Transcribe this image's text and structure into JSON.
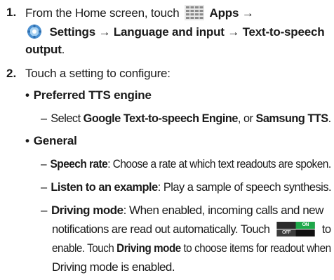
{
  "step1": {
    "number": "1.",
    "intro": "From the Home screen, touch",
    "apps_label": "Apps →",
    "path": "Settings → Language and input → Text-to-speech",
    "path_end": "output",
    "period": "."
  },
  "step2": {
    "number": "2.",
    "text": "Touch a setting to configure:"
  },
  "preferred": {
    "bullet": "•",
    "title": "Preferred TTS engine",
    "dash": "–",
    "select_prefix": "Select",
    "option1": "Google Text-to-speech Engine",
    "or_text": ", or",
    "option2": "Samsung TTS",
    "end": "."
  },
  "general": {
    "bullet": "•",
    "title": "General",
    "items": [
      {
        "dash": "–",
        "term": "Speech rate",
        "desc": ": Choose a rate at which text readouts are spoken."
      },
      {
        "dash": "–",
        "term": "Listen to an example",
        "desc": ": Play a sample of speech synthesis."
      },
      {
        "dash": "–",
        "term": "Driving mode",
        "desc_line1": ": When enabled, incoming calls and new",
        "desc_line2a": "notifications are read out automatically. Touch",
        "desc_line2b": "to",
        "desc_line3a": "enable. Touch",
        "desc_line3_term": "Driving mode",
        "desc_line3b": "to choose items for readout when",
        "desc_line4": "Driving mode is enabled."
      }
    ]
  },
  "toggle": {
    "on_label": "ON",
    "off_label": "OFF"
  },
  "colors": {
    "toggle_on": "#1ea84a",
    "text": "#1a1a1a"
  }
}
